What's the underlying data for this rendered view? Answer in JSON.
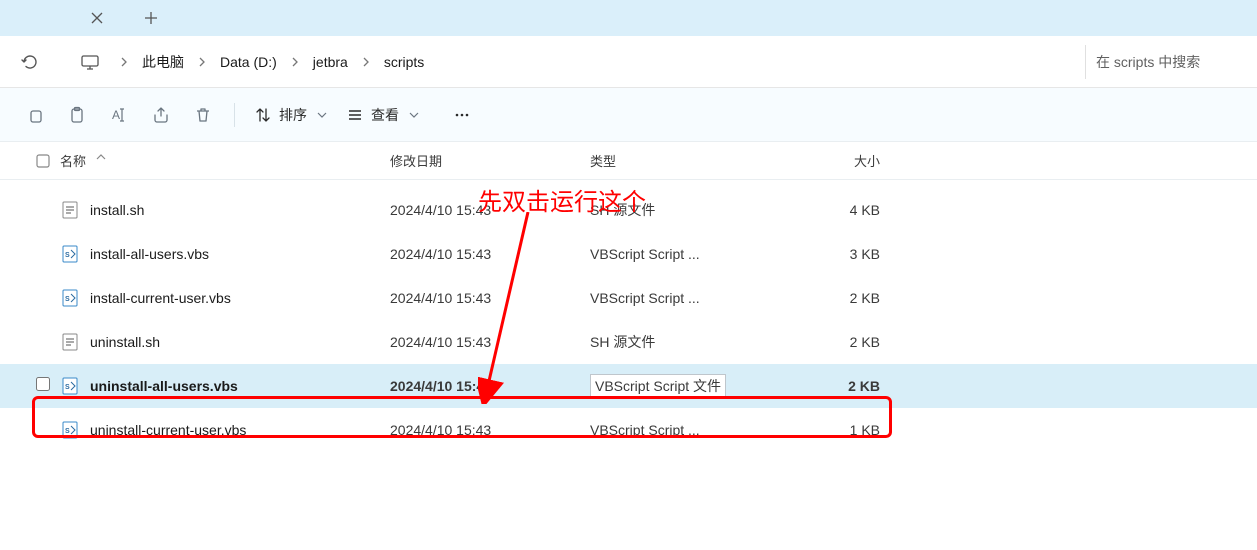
{
  "breadcrumb": {
    "root_label": "此电脑",
    "items": [
      "Data (D:)",
      "jetbra",
      "scripts"
    ]
  },
  "search": {
    "placeholder": "在 scripts 中搜索"
  },
  "toolbar": {
    "sort_label": "排序",
    "view_label": "查看"
  },
  "columns": {
    "name": "名称",
    "date": "修改日期",
    "type": "类型",
    "size": "大小"
  },
  "annotation": {
    "text": "先双击运行这个"
  },
  "files": [
    {
      "name": "install.sh",
      "date": "2024/4/10 15:43",
      "type": "SH 源文件",
      "size": "4 KB",
      "icon": "sh"
    },
    {
      "name": "install-all-users.vbs",
      "date": "2024/4/10 15:43",
      "type": "VBScript Script ...",
      "size": "3 KB",
      "icon": "vbs"
    },
    {
      "name": "install-current-user.vbs",
      "date": "2024/4/10 15:43",
      "type": "VBScript Script ...",
      "size": "2 KB",
      "icon": "vbs"
    },
    {
      "name": "uninstall.sh",
      "date": "2024/4/10 15:43",
      "type": "SH 源文件",
      "size": "2 KB",
      "icon": "sh"
    },
    {
      "name": "uninstall-all-users.vbs",
      "date": "2024/4/10 15:43",
      "type": "VBScript Script 文件",
      "size": "2 KB",
      "icon": "vbs",
      "selected": true
    },
    {
      "name": "uninstall-current-user.vbs",
      "date": "2024/4/10 15:43",
      "type": "VBScript Script ...",
      "size": "1 KB",
      "icon": "vbs"
    }
  ]
}
